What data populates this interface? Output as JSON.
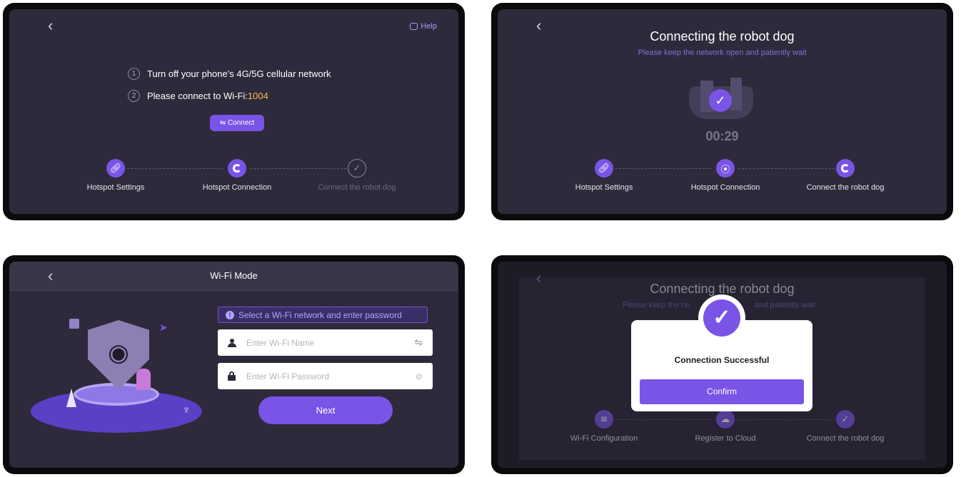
{
  "p1": {
    "back": "‹",
    "help": "Help",
    "step1_num": "1",
    "step1_text": "Turn off your phone's 4G/5G cellular network",
    "step2_num": "2",
    "step2_text": "Please connect to Wi-Fi:",
    "wifi_id": "1004",
    "connect_label": "⇋ Connect",
    "steps": [
      "Hotspot Settings",
      "Hotspot Connection",
      "Connect the robot dog"
    ]
  },
  "p2": {
    "back": "‹",
    "title": "Connecting the robot dog",
    "subtitle": "Please keep the network open and patiently wait",
    "timer": "00:29",
    "steps": [
      "Hotspot Settings",
      "Hotspot Connection",
      "Connect the robot dog"
    ]
  },
  "p3": {
    "back": "‹",
    "title": "Wi-Fi Mode",
    "notice": "Select a Wi-Fi network and enter password",
    "name_placeholder": "Enter Wi-Fi Name",
    "pass_placeholder": "Enter Wi-Fi Password",
    "next_label": "Next"
  },
  "p4": {
    "back": "‹",
    "title": "Connecting the robot dog",
    "subtitle_left": "Please keep the ne",
    "subtitle_right": "and patiently wait",
    "dialog_text": "Connection Successful",
    "confirm_label": "Confirm",
    "steps": [
      "Wi-Fi Configuration",
      "Register to Cloud",
      "Connect the robot dog"
    ]
  },
  "colors": {
    "accent": "#7a54e6",
    "highlight": "#f2c14e",
    "background": "#2e2a3b"
  }
}
